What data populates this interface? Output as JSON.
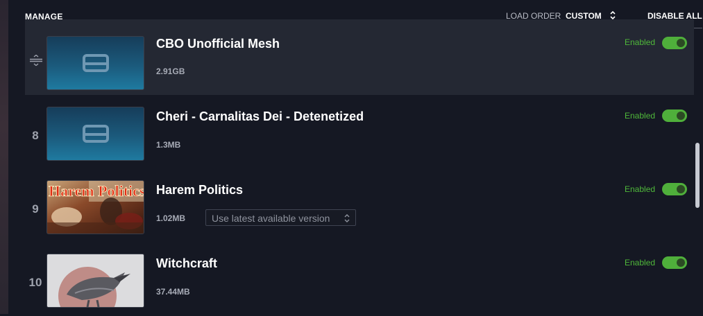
{
  "header": {
    "title": "MANAGE",
    "load_order_label": "LOAD ORDER",
    "load_order_value": "CUSTOM",
    "disable_all": "DISABLE ALL"
  },
  "mods": [
    {
      "index": "",
      "name": "CBO Unofficial Mesh",
      "size": "2.91GB",
      "status": "Enabled",
      "enabled": true,
      "thumbnail": "drive-icon"
    },
    {
      "index": "8",
      "name": "Cheri - Carnalitas Dei - Detenetized",
      "size": "1.3MB",
      "status": "Enabled",
      "enabled": true,
      "thumbnail": "drive-icon"
    },
    {
      "index": "9",
      "name": "Harem Politics",
      "size": "1.02MB",
      "status": "Enabled",
      "enabled": true,
      "thumbnail": "harem-politics-art",
      "thumbnail_text": "Harem Politics",
      "version_select": "Use latest available version"
    },
    {
      "index": "10",
      "name": "Witchcraft",
      "size": "37.44MB",
      "status": "Enabled",
      "enabled": true,
      "thumbnail": "raven-art"
    }
  ],
  "colors": {
    "background": "#151823",
    "selected_row": "#242833",
    "enabled_green": "#4fb83a",
    "thumb_blue": "#1b5a7c"
  }
}
